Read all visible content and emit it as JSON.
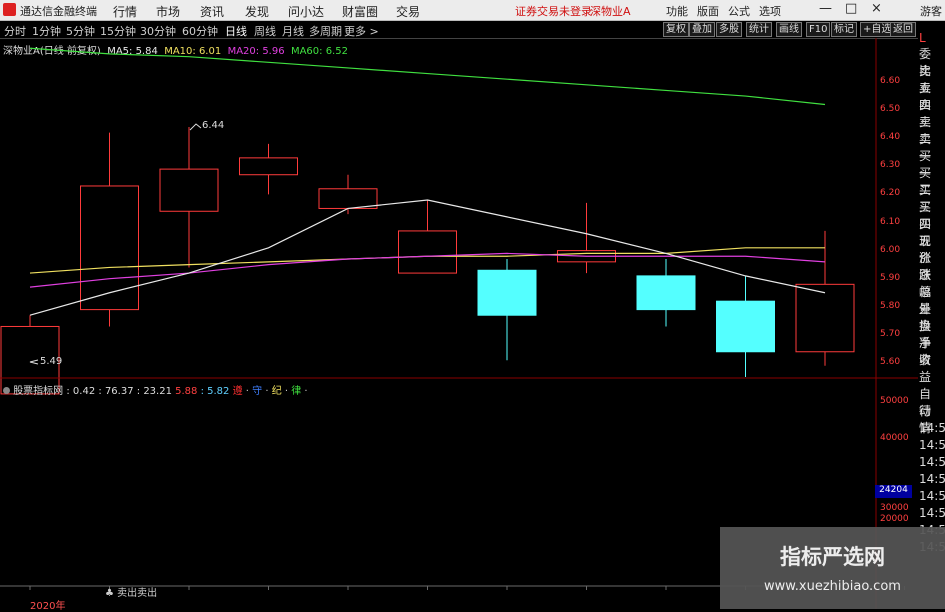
{
  "titlebar": {
    "app_name": "通达信金融终端",
    "menu": [
      "行情",
      "市场",
      "资讯",
      "发现",
      "问小达",
      "财富圈",
      "交易"
    ],
    "status": "证券交易未登录",
    "stock": "深物业A",
    "tools": [
      "功能",
      "版面",
      "公式",
      "选项"
    ],
    "account": "游客",
    "win_buttons": [
      "—",
      "□",
      "×"
    ]
  },
  "periods": [
    "分时",
    "1分钟",
    "5分钟",
    "15分钟",
    "30分钟",
    "60分钟",
    "日线",
    "周线",
    "月线",
    "多周期",
    "更多 >"
  ],
  "active_period": "日线",
  "right_buttons": [
    "复权",
    "叠加",
    "多股",
    "统计",
    "画线",
    "F10",
    "标记",
    "+自选",
    "返回"
  ],
  "chart_info": {
    "stock_label": "深物业A(日线 前复权)",
    "ma5": "MA5: 5.84",
    "ma10": "MA10: 6.01",
    "ma20": "MA20: 5.96",
    "ma60": "MA60: 6.52",
    "high_label": "6.44",
    "low_label": "5.49",
    "colors": {
      "ma5": "#e8e8e8",
      "ma10": "#f0e060",
      "ma20": "#e040e0",
      "ma60": "#40e040"
    }
  },
  "indicator": {
    "name": "股票指标网",
    "v1": ": 0.42",
    "v2": ": 76.37",
    "v3": ": 23.21",
    "v4": "5.88",
    "v5": ": 5.82",
    "tag1": "遵",
    "tag2": "守",
    "tag3": "纪",
    "tag4": "律",
    "bottom_tag": "♣ 卖出卖出"
  },
  "price_axis": [
    "6.60",
    "6.50",
    "6.40",
    "6.30",
    "6.20",
    "6.10",
    "6.00",
    "5.90",
    "5.80",
    "5.70",
    "5.60"
  ],
  "vol_axis": [
    "50000",
    "40000",
    "30000",
    "20000"
  ],
  "vol_current": "24204",
  "year_label": "2020年",
  "right_strip": {
    "header": "L",
    "items": [
      "委比",
      "卖五",
      "卖四",
      "卖三",
      "卖二",
      "卖一",
      "买一",
      "买二",
      "买三",
      "买四",
      "买五",
      "现价",
      "涨跌",
      "涨幅",
      "总量",
      "外盘",
      "换手",
      "净资",
      "收益"
    ],
    "lower": [
      "自动",
      "行情",
      "14:5",
      "14:5",
      "14:5",
      "14:5",
      "14:5",
      "14:5",
      "14:5",
      "14:5"
    ]
  },
  "watermark": {
    "title": "指标严选网",
    "url": "www.xuezhibiao.com"
  },
  "candles": [
    {
      "open": 5.49,
      "close": 5.73,
      "high": 5.77,
      "low": 5.49
    },
    {
      "open": 5.79,
      "close": 6.23,
      "high": 6.42,
      "low": 5.73
    },
    {
      "open": 6.14,
      "close": 6.29,
      "high": 6.44,
      "low": 5.94
    },
    {
      "open": 6.27,
      "close": 6.33,
      "high": 6.38,
      "low": 6.2
    },
    {
      "open": 6.15,
      "close": 6.22,
      "high": 6.27,
      "low": 6.13
    },
    {
      "open": 5.92,
      "close": 6.07,
      "high": 6.18,
      "low": 5.92
    },
    {
      "open": 5.93,
      "close": 5.77,
      "high": 5.97,
      "low": 5.61
    },
    {
      "open": 5.96,
      "close": 6.0,
      "high": 6.17,
      "low": 5.92
    },
    {
      "open": 5.91,
      "close": 5.79,
      "high": 5.97,
      "low": 5.73
    },
    {
      "open": 5.82,
      "close": 5.64,
      "high": 5.91,
      "low": 5.55
    },
    {
      "open": 5.64,
      "close": 5.88,
      "high": 6.07,
      "low": 5.59
    }
  ],
  "ma_lines": {
    "ma5": [
      5.77,
      5.85,
      5.92,
      6.01,
      6.15,
      6.18,
      6.12,
      6.06,
      5.99,
      5.91,
      5.85
    ],
    "ma10": [
      5.92,
      5.94,
      5.95,
      5.96,
      5.97,
      5.98,
      5.98,
      5.99,
      5.99,
      6.01,
      6.01
    ],
    "ma20": [
      5.87,
      5.9,
      5.92,
      5.95,
      5.97,
      5.98,
      5.99,
      5.98,
      5.98,
      5.98,
      5.96
    ],
    "ma60": [
      6.72,
      6.7,
      6.69,
      6.67,
      6.65,
      6.63,
      6.61,
      6.59,
      6.57,
      6.55,
      6.52
    ]
  }
}
